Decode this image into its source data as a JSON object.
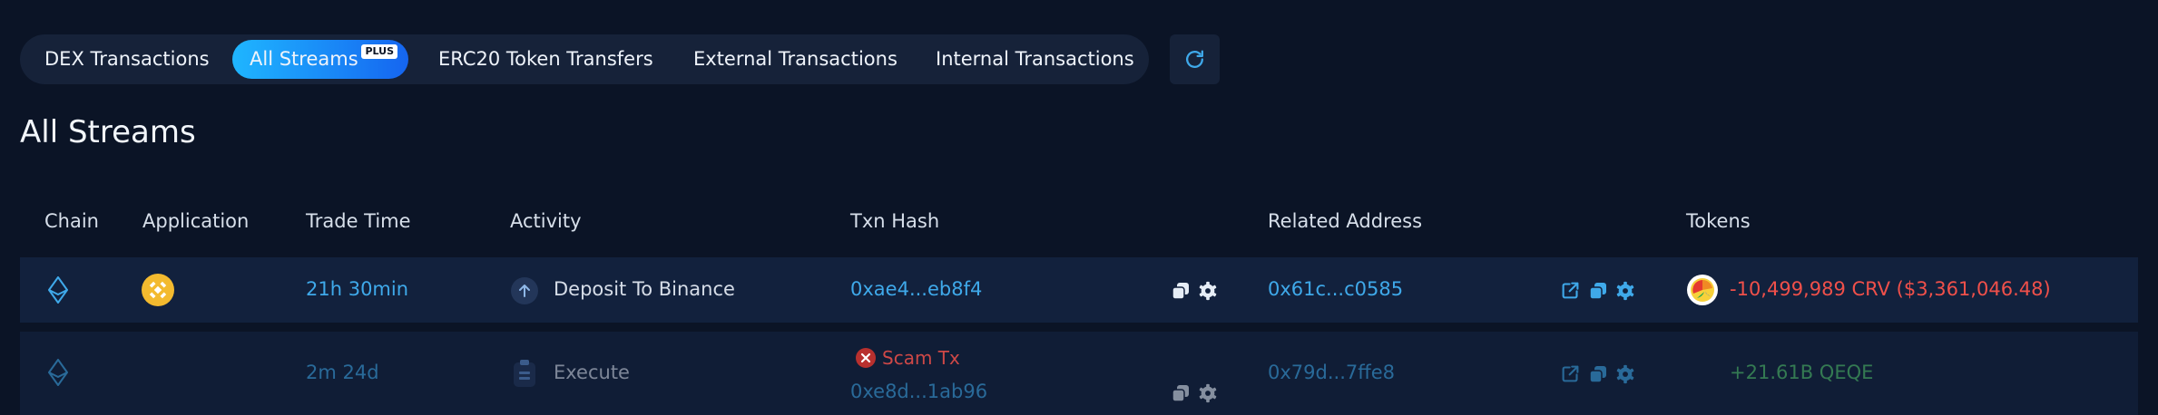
{
  "tabs": [
    {
      "label": "DEX Transactions"
    },
    {
      "label": "All Streams",
      "badge": "PLUS",
      "active": true
    },
    {
      "label": "ERC20 Token Transfers"
    },
    {
      "label": "External Transactions"
    },
    {
      "label": "Internal Transactions"
    }
  ],
  "refresh_icon": "refresh-icon",
  "page_title": "All Streams",
  "table": {
    "columns": [
      "Chain",
      "Application",
      "Trade Time",
      "Activity",
      "Txn Hash",
      "Related Address",
      "Tokens"
    ],
    "rows": [
      {
        "chain_icon": "ethereum-icon",
        "app_icon": "binance-icon",
        "trade_time": "21h 30min",
        "activity_icon": "arrow-up-icon",
        "activity": "Deposit To Binance",
        "scam_label": "",
        "txn_hash": "0xae4...eb8f4",
        "related_address": "0x61c...c0585",
        "token_icon": "crv-token-icon",
        "tokens": "-10,499,989 CRV ($3,361,046.48)"
      },
      {
        "chain_icon": "ethereum-icon",
        "trade_time": "2m 24d",
        "activity_icon": "clipboard-icon",
        "activity": "Execute",
        "scam_label": "Scam Tx",
        "txn_hash": "0xe8d...1ab96",
        "related_address": "0x79d...7ffe8",
        "tokens": "+21.61B QEQE"
      }
    ]
  },
  "colors": {
    "background": "#0b1426",
    "accent": "#3fa9ea",
    "negative": "#f0504a",
    "positive": "#53c76a"
  }
}
